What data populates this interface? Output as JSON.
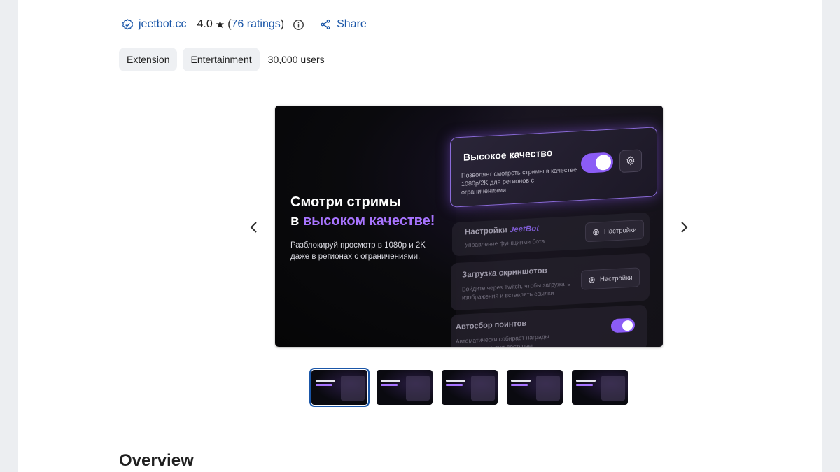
{
  "publisher": {
    "name": "jeetbot.cc"
  },
  "rating": {
    "value": "4.0",
    "star": "★",
    "open_paren": "(",
    "count_label": "76 ratings",
    "close_paren": ")"
  },
  "share_label": "Share",
  "chips": [
    "Extension",
    "Entertainment"
  ],
  "users": "30,000 users",
  "hero": {
    "title_line1": "Смотри стримы",
    "title_line2_prefix": "в ",
    "title_line2_accent": "высоком качестве!",
    "description": "Разблокируй просмотр в 1080p и 2K даже в регионах с ограничениями.",
    "card_quality": {
      "title": "Высокое качество",
      "description": "Позволяет смотреть стримы в качестве 1080p/2K для регионов с ограничениями"
    },
    "card_settings": {
      "title_prefix": "Настройки ",
      "title_accent": "JeetBot",
      "description": "Управление функциями бота",
      "button": "Настройки"
    },
    "card_screens": {
      "title": "Загрузка скриншотов",
      "description": "Войдите через Twitch, чтобы загружать изображения и вставлять ссылки",
      "button": "Настройки"
    },
    "card_points": {
      "title": "Автосбор поинтов",
      "description": "Автоматически собирает награды канала, когда они доступны"
    }
  },
  "thumbnails_count": 5,
  "overview_heading": "Overview",
  "colors": {
    "accent": "#8b5cf6",
    "link": "#1a56a8",
    "chip_bg": "#eef0f3"
  }
}
